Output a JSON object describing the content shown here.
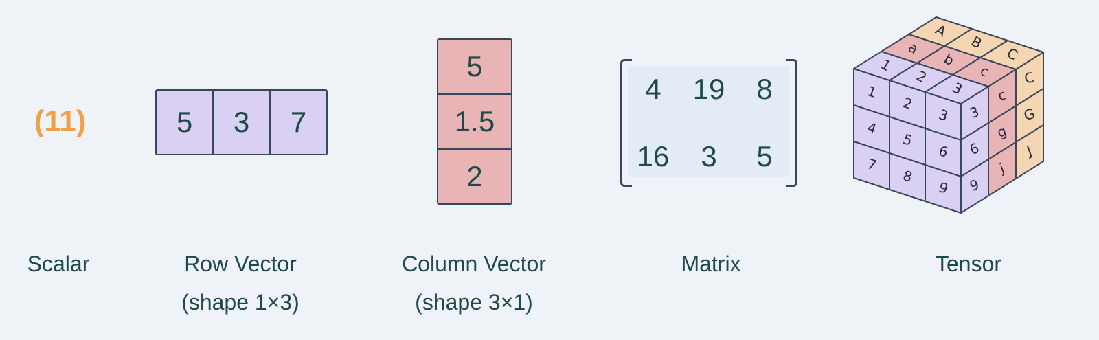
{
  "scalar": {
    "value": "(11)",
    "label": "Scalar"
  },
  "row_vector": {
    "values": [
      "5",
      "3",
      "7"
    ],
    "label": "Row Vector",
    "shape": "(shape 1×3)"
  },
  "column_vector": {
    "values": [
      "5",
      "1.5",
      "2"
    ],
    "label": "Column Vector",
    "shape": "(shape 3×1)"
  },
  "matrix": {
    "rows": [
      [
        "4",
        "19",
        "8"
      ],
      [
        "16",
        "3",
        "5"
      ]
    ],
    "label": "Matrix"
  },
  "tensor": {
    "label": "Tensor",
    "front_face": [
      [
        "1",
        "2",
        "3"
      ],
      [
        "4",
        "5",
        "6"
      ],
      [
        "7",
        "8",
        "9"
      ]
    ],
    "top_face": [
      [
        "A",
        "B",
        "C"
      ],
      [
        "a",
        "b",
        "c"
      ],
      [
        "1",
        "2",
        "3"
      ]
    ],
    "right_face": [
      [
        "3",
        "c",
        "C"
      ],
      [
        "6",
        "g",
        "G"
      ],
      [
        "9",
        "j",
        "J"
      ]
    ]
  },
  "colors": {
    "background": "#eff3f8",
    "scalar": "#f0a04b",
    "purple": "#d9d0f3",
    "pink": "#e9b4b6",
    "peach": "#f5d6b3",
    "matrix_bg": "#e2ebf6",
    "text": "#1f4a45"
  }
}
